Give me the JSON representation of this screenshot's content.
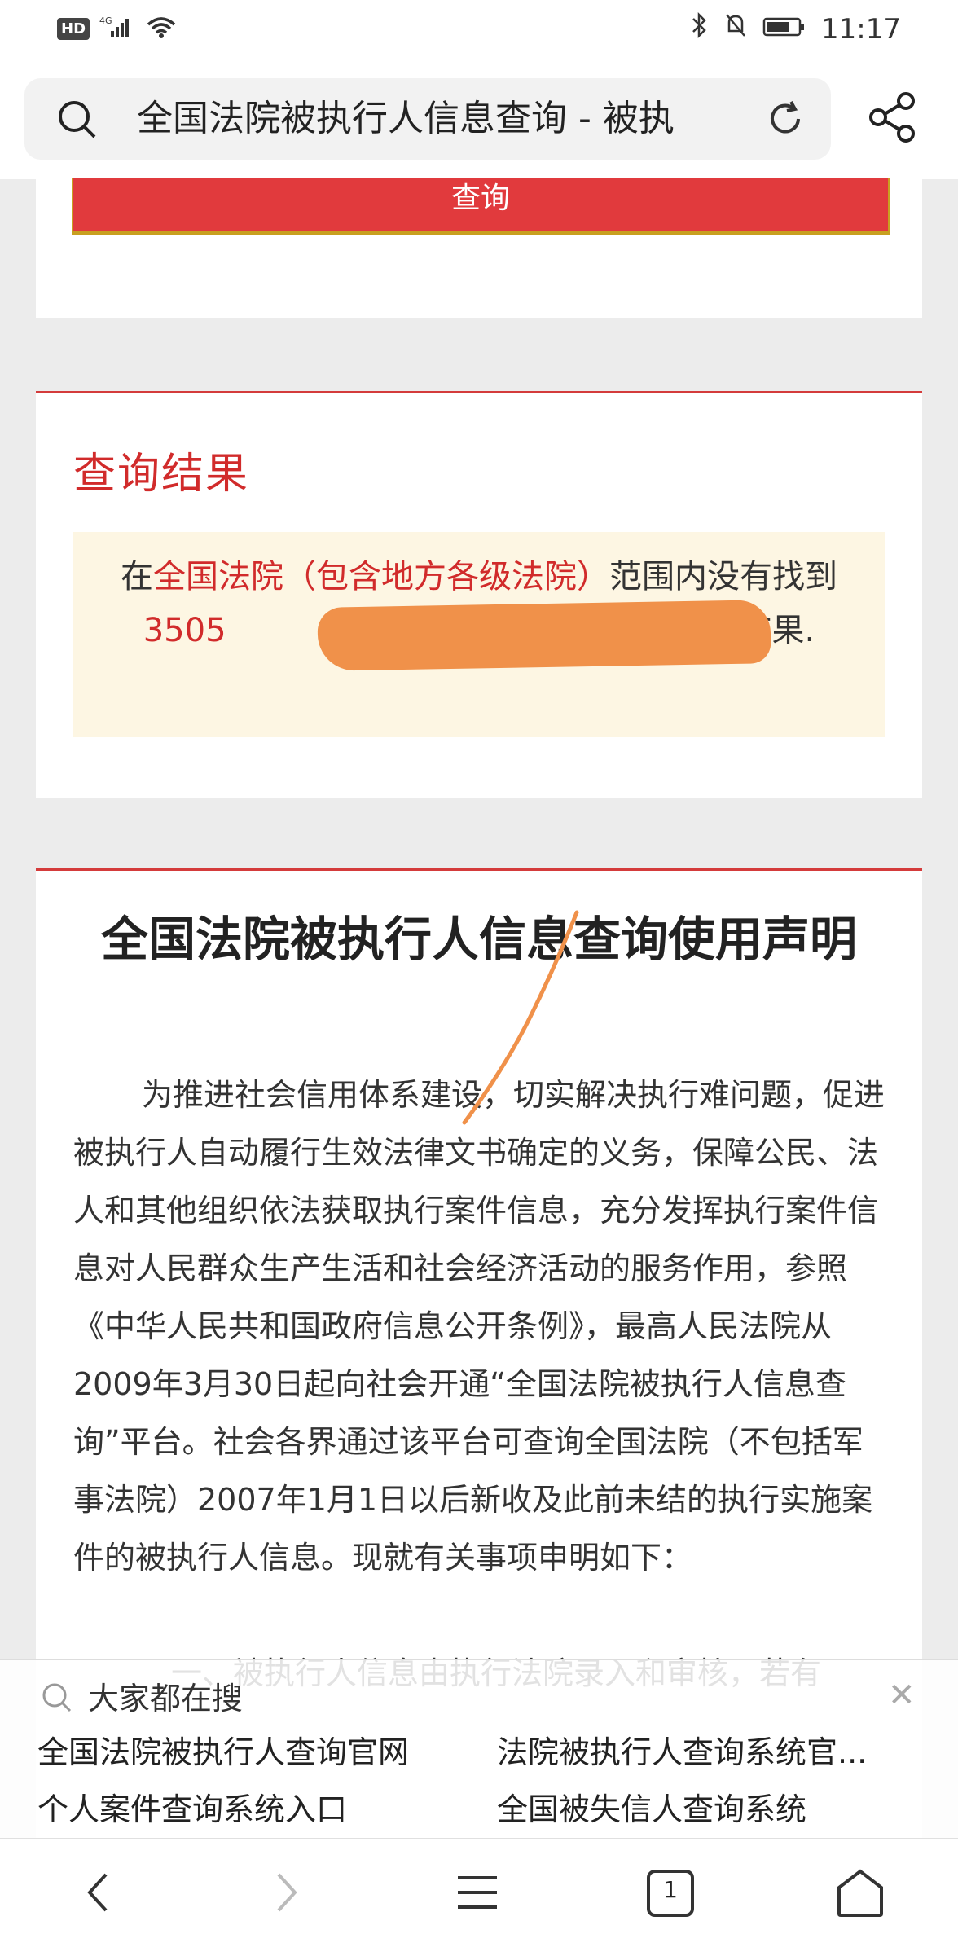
{
  "status": {
    "network": "4G",
    "hd": "HD",
    "time": "11:17"
  },
  "browser": {
    "address_title": "全国法院被执行人信息查询 - 被执"
  },
  "query_card": {
    "button_label": "查询"
  },
  "result": {
    "title": "查询结果",
    "text_prefix": "在",
    "scope": "全国法院（包含地方各级法院）",
    "text_middle": "范围内没有找到 ",
    "id_visible": "3505",
    "text_suffix": "相关的结果."
  },
  "declaration": {
    "title": "全国法院被执行人信息查询使用声明",
    "paragraph1": "为推进社会信用体系建设，切实解决执行难问题，促进被执行人自动履行生效法律文书确定的义务，保障公民、法人和其他组织依法获取执行案件信息，充分发挥执行案件信息对人民群众生产生活和社会经济活动的服务作用，参照《中华人民共和国政府信息公开条例》，最高人民法院从2009年3月30日起向社会开通“全国法院被执行人信息查询”平台。社会各界通过该平台可查询全国法院（不包括军事法院）2007年1月1日以后新收及此前未结的执行实施案件的被执行人信息。现就有关事项申明如下：",
    "paragraph2": "一、被执行人信息由执行法院录入和审核，若有"
  },
  "hot_search": {
    "label": "大家都在搜",
    "items": [
      "全国法院被执行人查询官网",
      "法院被执行人查询系统官...",
      "个人案件查询系统入口",
      "全国被失信人查询系统"
    ]
  },
  "nav": {
    "tab_count": "1"
  },
  "colors": {
    "accent": "#d12b2b",
    "button": "#e13a3d",
    "result_bg": "#fdf6e3"
  }
}
